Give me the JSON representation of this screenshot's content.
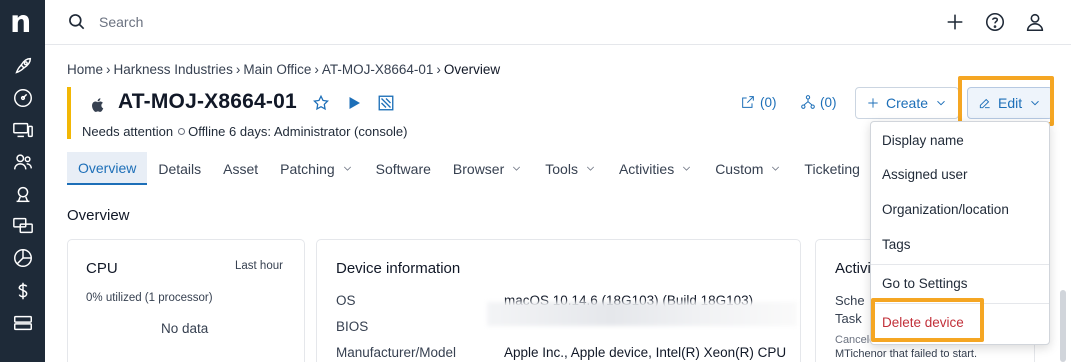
{
  "search": {
    "placeholder": "Search"
  },
  "breadcrumb": [
    "Home",
    "Harkness Industries",
    "Main Office",
    "AT-MOJ-X8664-01",
    "Overview"
  ],
  "device": {
    "name": "AT-MOJ-X8664-01",
    "status": "Needs attention",
    "offline": "Offline 6 days: Administrator (console)",
    "tickets_count": "(0)",
    "related_count": "(0)"
  },
  "actions": {
    "create": "Create",
    "edit": "Edit"
  },
  "tabs": [
    "Overview",
    "Details",
    "Asset",
    "Patching",
    "Software",
    "Browser",
    "Tools",
    "Activities",
    "Custom",
    "Ticketing"
  ],
  "tabs_with_chevron": [
    "Patching",
    "Browser",
    "Tools",
    "Activities",
    "Custom"
  ],
  "section_title": "Overview",
  "cpu_card": {
    "title": "CPU",
    "period": "Last hour",
    "utilization": "0% utilized (1 processor)",
    "empty": "No data"
  },
  "device_info": {
    "title": "Device information",
    "rows": [
      {
        "label": "OS",
        "value": "macOS 10.14.6 (18G103) (Build 18G103)"
      },
      {
        "label": "BIOS",
        "value": ""
      },
      {
        "label": "Manufacturer/Model",
        "value": "Apple Inc., Apple device, Intel(R) Xeon(R) CPU"
      }
    ]
  },
  "activity_card": {
    "title": "Activi",
    "line1": "Sche",
    "line2": "Task",
    "footer1": "Canceled scheduled task Test Task",
    "footer2": "MTichenor that failed to start."
  },
  "edit_menu": {
    "items": [
      "Display name",
      "Assigned user",
      "Organization/location",
      "Tags",
      "Go to Settings",
      "Delete device"
    ]
  },
  "colors": {
    "accent": "#1d6fb8",
    "highlight": "#f5a623",
    "danger": "#c2303a",
    "nav": "#1e2a38",
    "status_bar": "#f2b705"
  }
}
